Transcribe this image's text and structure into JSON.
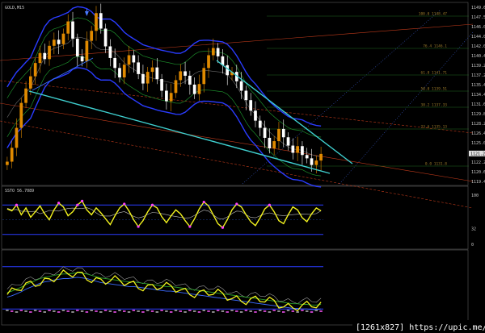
{
  "chart_data": [
    {
      "type": "line",
      "title": "GOLD,M15",
      "series": [
        {
          "values": [
            1122.0,
            1124.5,
            1128.1,
            1132.6,
            1135.2,
            1137.4,
            1139.8,
            1141.6,
            1140.5,
            1142.9,
            1144.0,
            1143.2,
            1145.1,
            1147.3,
            1144.2,
            1141.0,
            1140.1,
            1143.8,
            1145.6,
            1148.8,
            1146.0,
            1142.8,
            1140.7,
            1138.9,
            1137.2,
            1139.5,
            1141.2,
            1139.9,
            1137.8,
            1136.1,
            1138.2,
            1139.0,
            1136.9,
            1134.8,
            1132.9,
            1134.4,
            1136.7,
            1138.3,
            1137.5,
            1135.9,
            1134.2,
            1136.0,
            1138.9,
            1141.2,
            1142.5,
            1141.0,
            1139.4,
            1137.6,
            1138.2,
            1136.5,
            1134.8,
            1133.1,
            1131.2,
            1129.4,
            1128.1,
            1126.3,
            1124.4,
            1125.7,
            1127.9,
            1126.4,
            1124.9,
            1123.6,
            1124.8,
            1123.2,
            1122.6,
            1121.4,
            1122.2,
            1123.4
          ]
        }
      ],
      "ylim": [
        1118.0,
        1150.0
      ],
      "y_ticks": [
        "1149.64",
        "1147.54",
        "1146.04",
        "1144.04",
        "1142.04",
        "1140.44",
        "1139.24",
        "1137.24",
        "1135.44",
        "1134.44",
        "1131.64",
        "1129.84",
        "1128.24",
        "1126.44",
        "1125.04",
        "1124.14",
        "1122.24",
        "1120.64",
        "1119.44"
      ],
      "fib_labels": [
        "100.0 1148.47",
        "76.4 1146.1",
        "61.8 1141.71",
        "50.0 1139.51",
        "38.2 1137.33",
        "23.6 1135.13",
        "0.0 1131.8"
      ],
      "price_marker": "1121.23",
      "grid": false
    },
    {
      "type": "line",
      "title": "SSTO 56.7089",
      "series": [
        {
          "values": [
            72,
            68,
            80,
            60,
            74,
            55,
            66,
            78,
            62,
            50,
            70,
            84,
            76,
            58,
            66,
            80,
            88,
            70,
            60,
            74,
            64,
            52,
            40,
            58,
            74,
            82,
            68,
            50,
            36,
            48,
            66,
            80,
            74,
            56,
            44,
            58,
            70,
            62,
            48,
            36,
            52,
            72,
            86,
            78,
            60,
            42,
            34,
            50,
            70,
            82,
            76,
            60,
            46,
            38,
            54,
            72,
            80,
            66,
            48,
            42,
            60,
            76,
            70,
            54,
            46,
            62,
            74,
            68
          ]
        }
      ],
      "ylim": [
        0,
        100
      ],
      "y_ticks": [
        "100",
        "32",
        "0"
      ],
      "grid": false
    },
    {
      "type": "line",
      "series": [
        {
          "values": [
            40,
            42,
            45,
            48,
            52,
            55,
            58,
            61,
            63,
            64,
            66,
            67,
            68,
            68,
            69,
            70,
            69,
            68,
            66,
            64,
            62,
            61,
            60,
            59,
            58,
            57,
            56,
            56,
            55,
            54,
            53,
            52,
            51,
            50,
            49,
            49,
            48,
            47,
            46,
            45,
            44,
            43,
            42,
            41,
            40,
            39,
            38,
            37,
            36,
            35,
            34,
            33,
            32,
            31,
            30,
            29,
            28,
            27,
            26,
            25,
            24,
            23,
            23,
            22,
            22,
            21,
            21,
            22
          ]
        }
      ],
      "ylim": [
        0,
        100
      ],
      "grid": false
    }
  ],
  "watermark": "[1261x827] https://upic.me/",
  "colors": {
    "background": "#000000",
    "bull_candle": "#e08a00",
    "bear_candle": "#ffffff",
    "trendline": "#3fd0d0",
    "channel": "#c03a1a",
    "band_blue": "#2a3cff",
    "band_green": "#1c8a2a",
    "oscillator": "#f2f21e",
    "overbought_dot": "#ff40ff",
    "fib_line": "#1f6a1f"
  }
}
